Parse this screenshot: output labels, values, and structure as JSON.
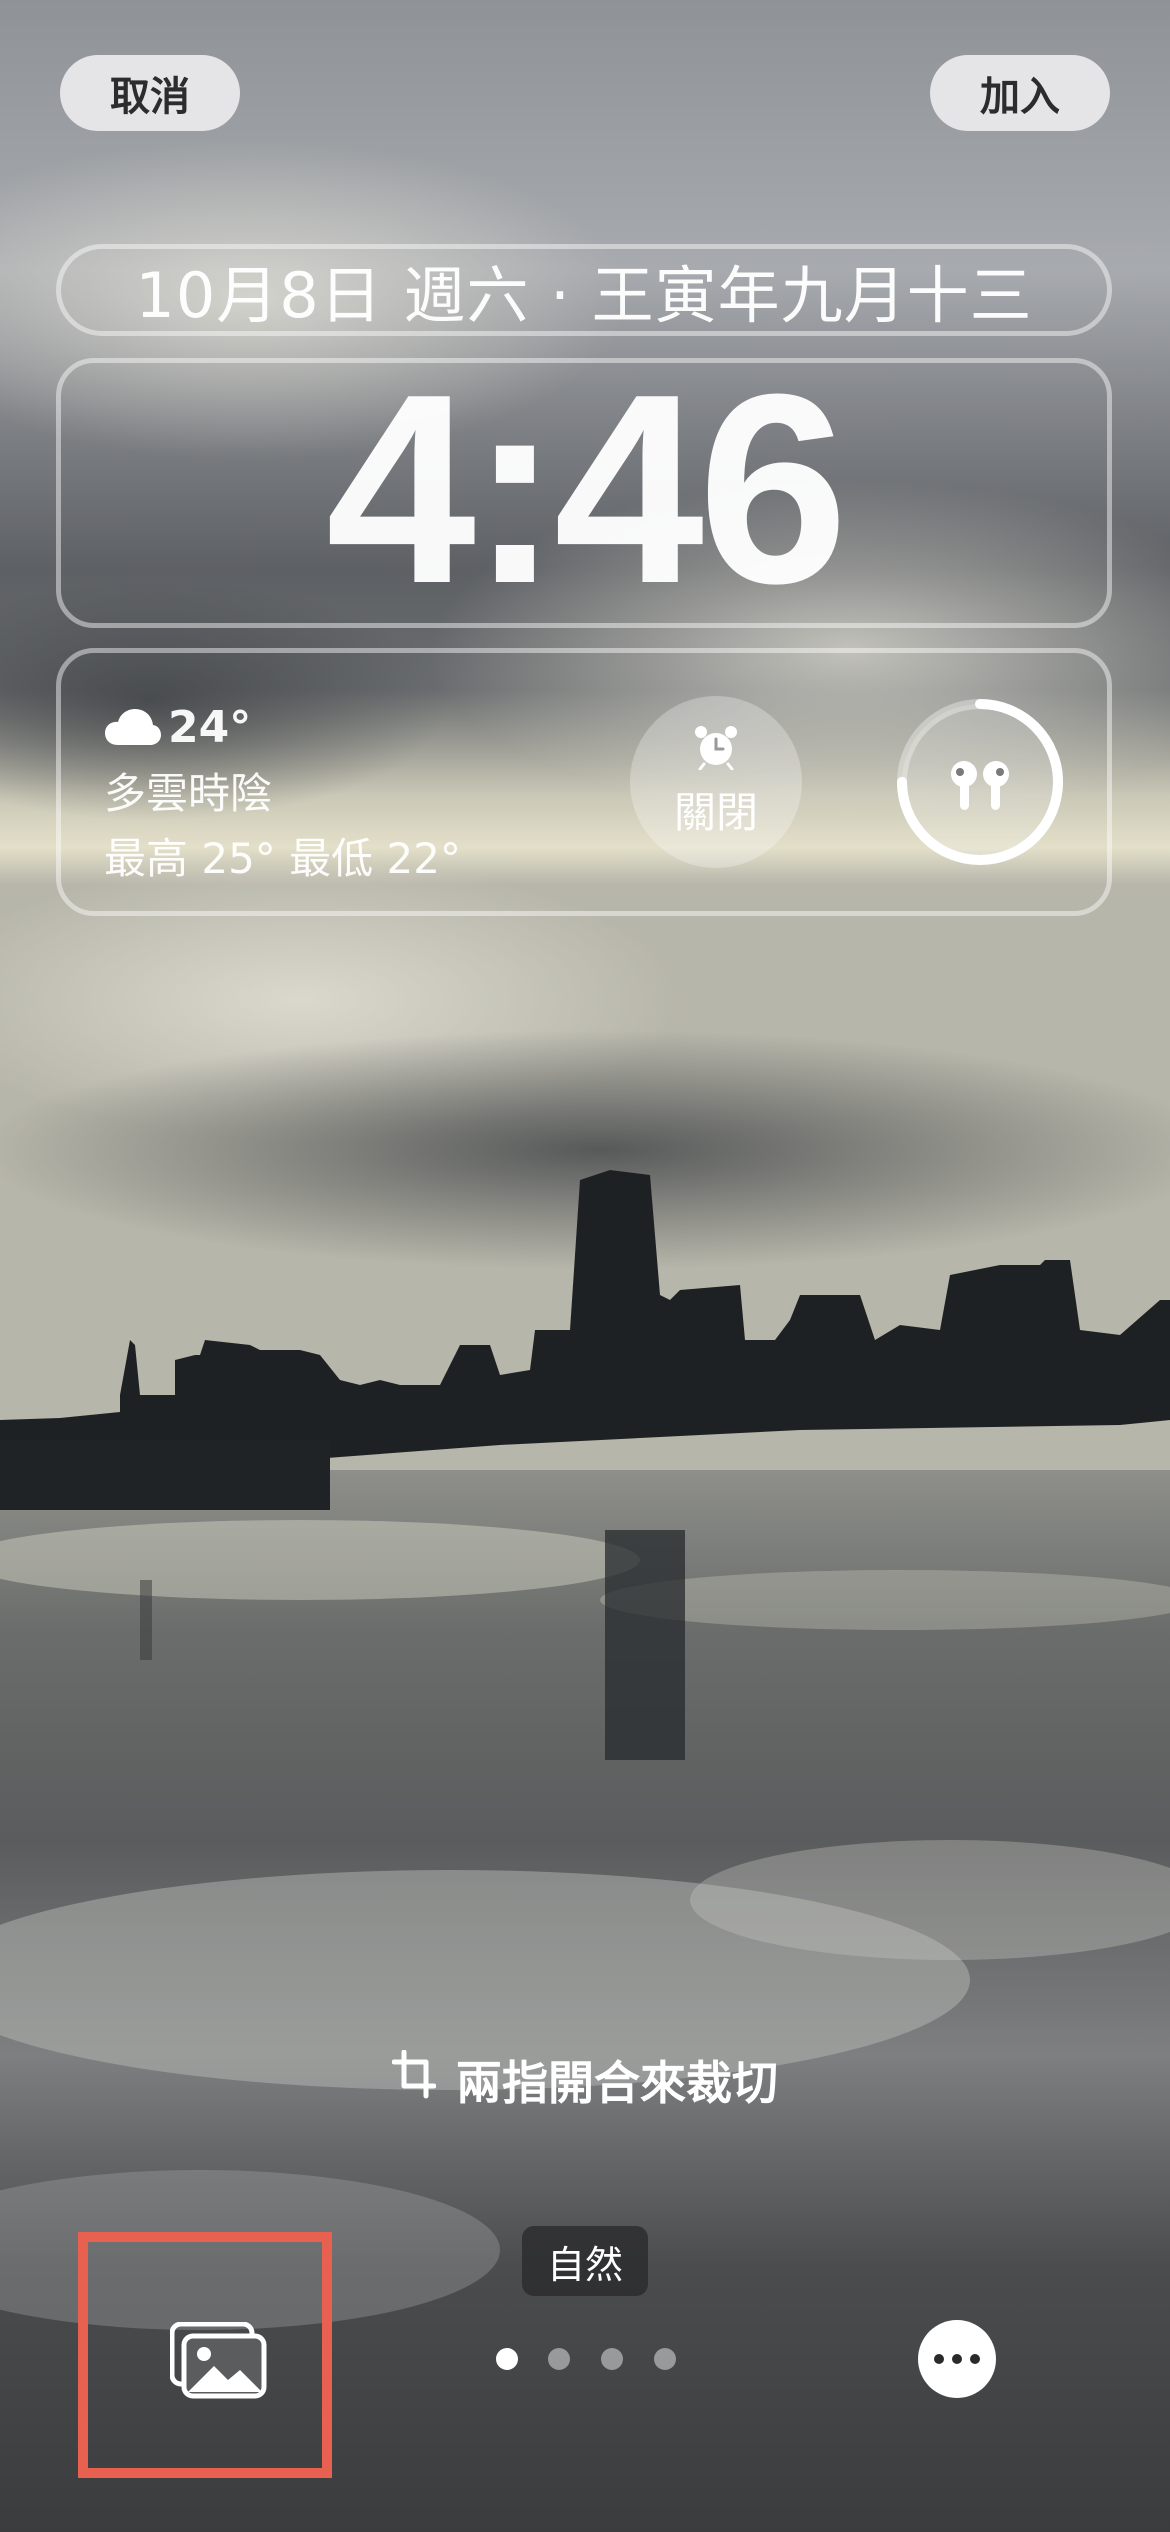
{
  "top_bar": {
    "cancel_label": "取消",
    "add_label": "加入"
  },
  "lock_screen": {
    "date_line": "10月8日 週六 · 王寅年九月十三",
    "time": "4:46"
  },
  "widgets": {
    "weather": {
      "icon": "cloud-icon",
      "temperature": "24°",
      "condition": "多雲時陰",
      "high_low": "最高 25° 最低 22°"
    },
    "alarm": {
      "icon": "alarm-clock-icon",
      "label": "關閉"
    },
    "battery": {
      "icon": "airpods-icon",
      "level": 0.75
    }
  },
  "hints": {
    "crop_hint": "兩指開合來裁切",
    "crop_icon": "crop-icon"
  },
  "bottom_bar": {
    "style_label": "自然",
    "page_count": 4,
    "active_page": 1,
    "photo_icon": "photo-library-icon",
    "more_icon": "more-icon",
    "highlight_color": "#e8604f"
  }
}
